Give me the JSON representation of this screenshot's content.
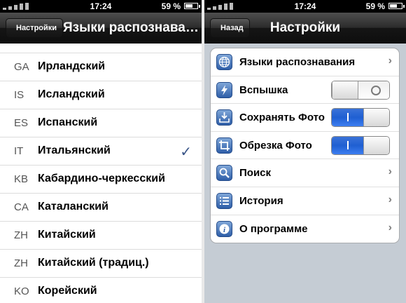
{
  "left_screen": {
    "statusbar": {
      "time": "17:24",
      "battery": "59 %"
    },
    "navbar": {
      "back_label": "Настройки",
      "title": "Языки распознава…"
    },
    "languages": [
      {
        "code": "GA",
        "name": "Ирландский"
      },
      {
        "code": "IS",
        "name": "Исландский"
      },
      {
        "code": "ES",
        "name": "Испанский"
      },
      {
        "code": "IT",
        "name": "Итальянский",
        "checkmark": "✓"
      },
      {
        "code": "KB",
        "name": "Кабардино-черкесский"
      },
      {
        "code": "CA",
        "name": "Каталанский"
      },
      {
        "code": "ZH",
        "name": "Китайский"
      },
      {
        "code": "ZH",
        "name": "Китайский (традиц.)"
      },
      {
        "code": "KO",
        "name": "Корейский"
      }
    ]
  },
  "right_screen": {
    "statusbar": {
      "time": "17:24",
      "battery": "59 %"
    },
    "navbar": {
      "back_label": "Назад",
      "title": "Настройки"
    },
    "settings": [
      {
        "label": "Языки распознавания",
        "icon": "globe-icon",
        "control": "chevron"
      },
      {
        "label": "Вспышка",
        "icon": "flash-icon",
        "control": "toggle",
        "state": "off"
      },
      {
        "label": "Сохранять Фото",
        "icon": "save-photo-icon",
        "control": "toggle",
        "state": "on"
      },
      {
        "label": "Обрезка Фото",
        "icon": "crop-icon",
        "control": "toggle",
        "state": "on"
      },
      {
        "label": "Поиск",
        "icon": "search-icon",
        "control": "chevron"
      },
      {
        "label": "История",
        "icon": "history-icon",
        "control": "chevron"
      },
      {
        "label": "О программе",
        "icon": "info-icon",
        "control": "chevron"
      }
    ]
  },
  "colors": {
    "checkmark": "#385487",
    "toggle_on": "#1f5fd2",
    "grouped_background": "#c5ccd4"
  }
}
